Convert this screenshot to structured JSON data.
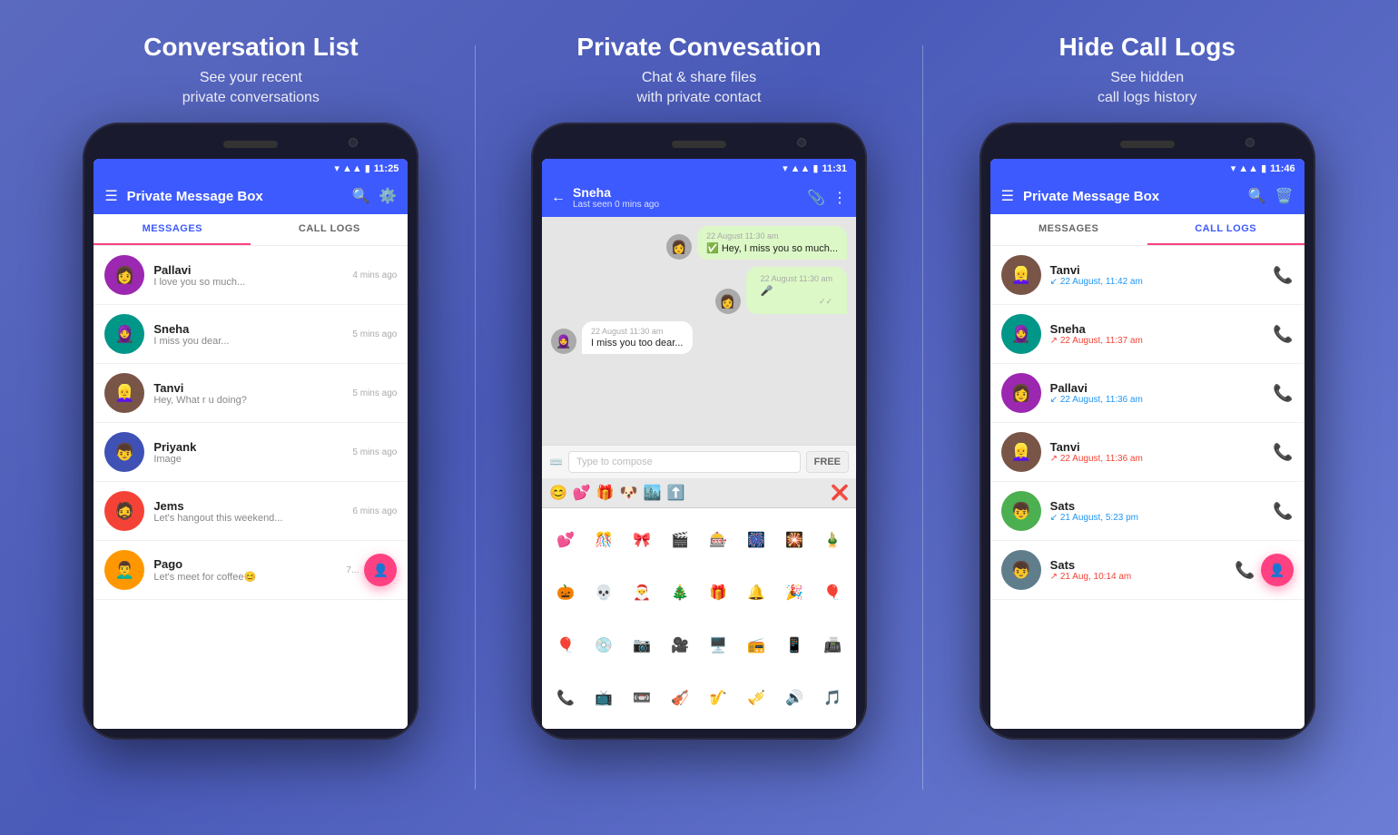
{
  "panels": [
    {
      "id": "conversation-list",
      "title": "Conversation List",
      "subtitle": "See your recent\nprivate conversations",
      "phone": {
        "time": "11:25",
        "app_bar": {
          "title": "Private Message Box",
          "icons": [
            "menu",
            "search",
            "settings"
          ]
        },
        "tabs": [
          "MESSAGES",
          "CALL LOGS"
        ],
        "active_tab": 0,
        "conversations": [
          {
            "name": "Pallavi",
            "preview": "I love you so much...",
            "time": "4 mins ago",
            "emoji": "👩"
          },
          {
            "name": "Sneha",
            "preview": "I miss you dear...",
            "time": "5 mins ago",
            "emoji": "🧕"
          },
          {
            "name": "Tanvi",
            "preview": "Hey, What r u doing?",
            "time": "5 mins ago",
            "emoji": "👱‍♀️"
          },
          {
            "name": "Priyank",
            "preview": "Image",
            "time": "5 mins ago",
            "emoji": "👦"
          },
          {
            "name": "Jems",
            "preview": "Let's hangout this weekend...",
            "time": "6 mins ago",
            "emoji": "🧔"
          },
          {
            "name": "Pago",
            "preview": "Let's meet for coffee😊",
            "time": "7 mins ago",
            "emoji": "👨‍🦱"
          }
        ]
      }
    },
    {
      "id": "private-conversation",
      "title": "Private Convesation",
      "subtitle": "Chat & share files\nwith private contact",
      "phone": {
        "time": "11:31",
        "chat": {
          "name": "Sneha",
          "status": "Last seen 0 mins ago",
          "messages": [
            {
              "dir": "out",
              "time": "22 August 11:30 am",
              "text": "✅ Hey, I miss you so much...",
              "avatar": "👩"
            },
            {
              "dir": "out",
              "time": "22 August 11:30 am",
              "text": "🎤",
              "avatar": "👩"
            },
            {
              "dir": "in",
              "time": "22 August 11:30 am",
              "text": "I miss you too dear...",
              "avatar": "🧕"
            }
          ]
        },
        "compose_placeholder": "Type to compose",
        "compose_btn": "FREE",
        "emoji_toolbar": [
          "😊",
          "💕",
          "🎁",
          "🐶",
          "🏙️",
          "⬆️",
          "❌"
        ],
        "emojis": [
          "💕",
          "🎊",
          "🎀",
          "🎬",
          "🎰",
          "🎆",
          "🎇",
          "🎍",
          "🎃",
          "💀",
          "🎅",
          "🎄",
          "🎁",
          "🔔",
          "🎉",
          "🎈",
          "💿",
          "📷",
          "🎥",
          "🖥️",
          "📻",
          "📱",
          "📠",
          "📞",
          "📺",
          "📼",
          "🎻",
          "🎷"
        ]
      }
    },
    {
      "id": "hide-call-logs",
      "title": "Hide Call Logs",
      "subtitle": "See hidden\ncall logs history",
      "phone": {
        "time": "11:46",
        "app_bar": {
          "title": "Private Message Box",
          "icons": [
            "menu",
            "search",
            "delete"
          ]
        },
        "tabs": [
          "MESSAGES",
          "CALL LOGS"
        ],
        "active_tab": 1,
        "call_logs": [
          {
            "name": "Tanvi",
            "time": "22 August, 11:42 am",
            "type": "incoming",
            "emoji": "👱‍♀️"
          },
          {
            "name": "Sneha",
            "time": "22 August, 11:37 am",
            "type": "outgoing",
            "emoji": "🧕"
          },
          {
            "name": "Pallavi",
            "time": "22 August, 11:36 am",
            "type": "incoming",
            "emoji": "👩"
          },
          {
            "name": "Tanvi",
            "time": "22 August, 11:36 am",
            "type": "missed",
            "emoji": "👱‍♀️"
          },
          {
            "name": "Sats",
            "time": "21 August, 5:23 pm",
            "type": "incoming",
            "emoji": "👦"
          },
          {
            "name": "Sats",
            "time": "21 Aug, 10:14 am",
            "type": "missed",
            "emoji": "👦"
          }
        ]
      }
    }
  ],
  "icons": {
    "menu": "☰",
    "search": "🔍",
    "settings": "⚙️",
    "delete": "🗑️",
    "back": "←",
    "attach": "📎",
    "more": "⋮",
    "add_person": "👤+",
    "phone": "📞"
  }
}
